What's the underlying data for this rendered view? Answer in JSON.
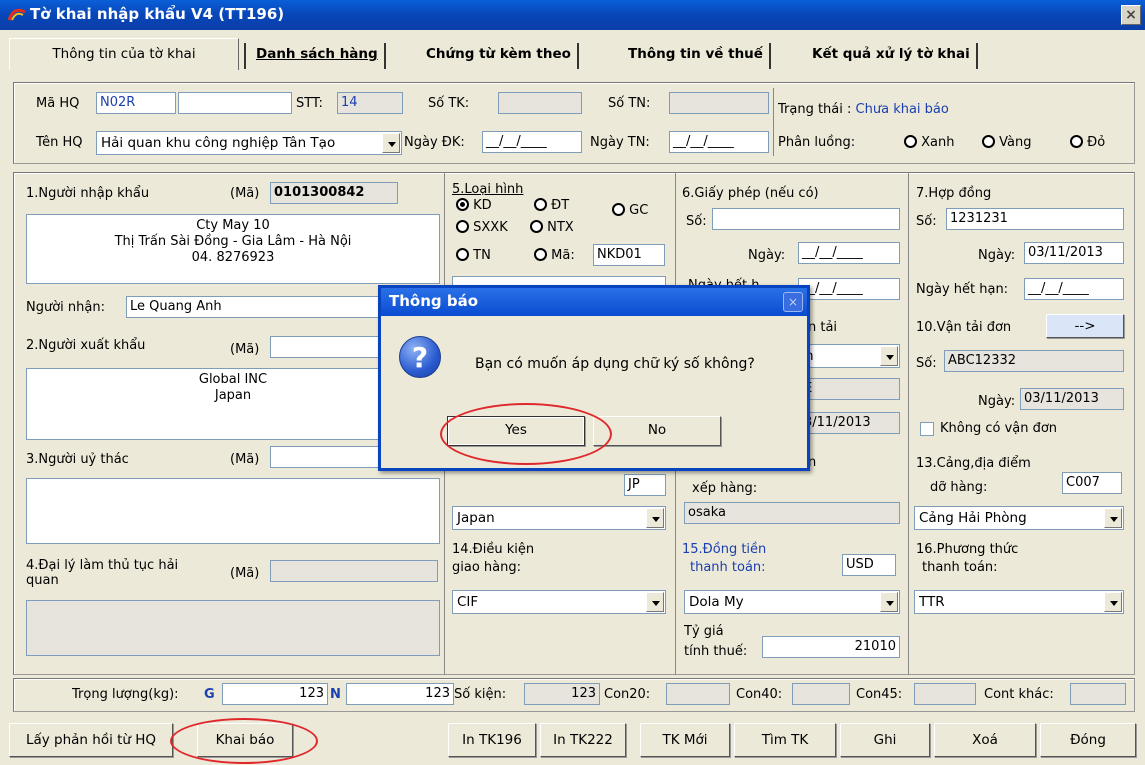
{
  "window": {
    "title": "Tờ khai nhập khẩu V4 (TT196)",
    "close": "×"
  },
  "tabs": [
    "Thông tin của tờ khai",
    "Danh sách hàng",
    "Chứng từ kèm theo",
    "Thông tin về thuế",
    "Kết quả xử lý tờ khai"
  ],
  "header": {
    "ma_hq_label": "Mã HQ",
    "ma_hq_value": "N02R",
    "stt_label": "STT:",
    "stt_value": "14",
    "so_tk_label": "Số TK:",
    "so_tn_label": "Số TN:",
    "trang_thai_label": "Trạng thái :",
    "trang_thai_value": "Chưa khai báo",
    "ten_hq_label": "Tên HQ",
    "ten_hq_value": "Hải quan khu công nghiệp Tân Tạo",
    "ngay_dk_label": "Ngày ĐK:",
    "ngay_tn_label": "Ngày TN:",
    "date_blank": "__/__/____",
    "phan_luong_label": "Phân luồng:",
    "luong_xanh": "Xanh",
    "luong_vang": "Vàng",
    "luong_do": "Đỏ"
  },
  "importer": {
    "label": "1.Người nhập khẩu",
    "ma_label": "(Mã)",
    "ma_value": "0101300842",
    "line1": "Cty May 10",
    "line2": "Thị Trấn Sài Đồng - Gia Lâm - Hà Nội",
    "line3": "04. 8276923",
    "nguoi_nhan_label": "Người nhận:",
    "nguoi_nhan_value": "Le Quang Anh"
  },
  "exporter": {
    "label": "2.Người xuất khẩu",
    "ma_label": "(Mã)",
    "line1": "Global INC",
    "line2": "Japan"
  },
  "trustor": {
    "label": "3.Người uỷ thác",
    "ma_label": "(Mã)"
  },
  "agent": {
    "label": "4.Đại lý làm thủ tục hải quan",
    "ma_label": "(Mã)"
  },
  "loai_hinh": {
    "label": "5.Loại hình",
    "kd": "KD",
    "dt": "ĐT",
    "gc": "GC",
    "sxxk": "SXXK",
    "ntx": "NTX",
    "tn": "TN",
    "ma_label": "Mã:",
    "ma_value": "NKD01"
  },
  "giay_phep": {
    "label": "6.Giấy phép (nếu có)",
    "so_label": "Số:",
    "ngay_label": "Ngày:",
    "date_blank": "__/__/____",
    "ngay_het_label": "Ngày hết h"
  },
  "hop_dong": {
    "label": "7.Hợp đồng",
    "so_label": "Số:",
    "so_value": "1231231",
    "ngay_label": "Ngày:",
    "ngay_value": "03/11/2013",
    "ngay_het_han_label": "Ngày hết hạn:",
    "date_blank": "__/__/____"
  },
  "van_tai": {
    "label_partial": "n tải",
    "select_partial": "n",
    "e_partial": "E",
    "date_partial": "3/11/2013"
  },
  "van_tai_don": {
    "label": "10.Vận tải đơn",
    "arrow_btn": "-->",
    "so_label": "Số:",
    "so_value": "ABC12332",
    "ngay_label": "Ngày:",
    "ngay_value": "03/11/2013",
    "khong_co_label": "Không có vận đơn"
  },
  "nuoc_xk": {
    "code": "JP",
    "value": "Japan"
  },
  "cang_xep": {
    "label_partial": "n",
    "label2": "xếp hàng:",
    "value": "osaka"
  },
  "cang_do": {
    "label1": "13.Cảng,địa điểm",
    "label2": "dỡ hàng:",
    "code": "C007",
    "value": "Cảng Hải Phòng"
  },
  "dieu_kien": {
    "label1": "14.Điều kiện",
    "label2": "giao hàng:",
    "value": "CIF"
  },
  "dong_tien": {
    "label1": "15.Đồng tiền",
    "label2": "thanh toán:",
    "code": "USD",
    "value": "Dola My",
    "ty_gia_label1": "Tỷ giá",
    "ty_gia_label2": "tính thuế:",
    "ty_gia_value": "21010"
  },
  "phuong_thuc": {
    "label1": "16.Phương thức",
    "label2": "thanh toán:",
    "value": "TTR"
  },
  "weights": {
    "label": "Trọng lượng(kg):",
    "g_label": "G",
    "g_value": "123",
    "n_label": "N",
    "n_value": "123",
    "so_kien_label": "Số kiện:",
    "so_kien_value": "123",
    "con20_label": "Con20:",
    "con40_label": "Con40:",
    "con45_label": "Con45:",
    "cont_khac_label": "Cont khác:"
  },
  "bottom_buttons": {
    "lay_phan_hoi": "Lấy phản hồi từ HQ",
    "khai_bao": "Khai báo",
    "in_tk196": "In TK196",
    "in_tk222": "In TK222",
    "tk_moi": "TK Mới",
    "tim_tk": "Tìm TK",
    "ghi": "Ghi",
    "xoa": "Xoá",
    "dong": "Đóng"
  },
  "dialog": {
    "title": "Thông báo",
    "close": "×",
    "message": "Bạn có muốn áp dụng chữ ký số không?",
    "icon": "?",
    "yes": "Yes",
    "no": "No"
  }
}
